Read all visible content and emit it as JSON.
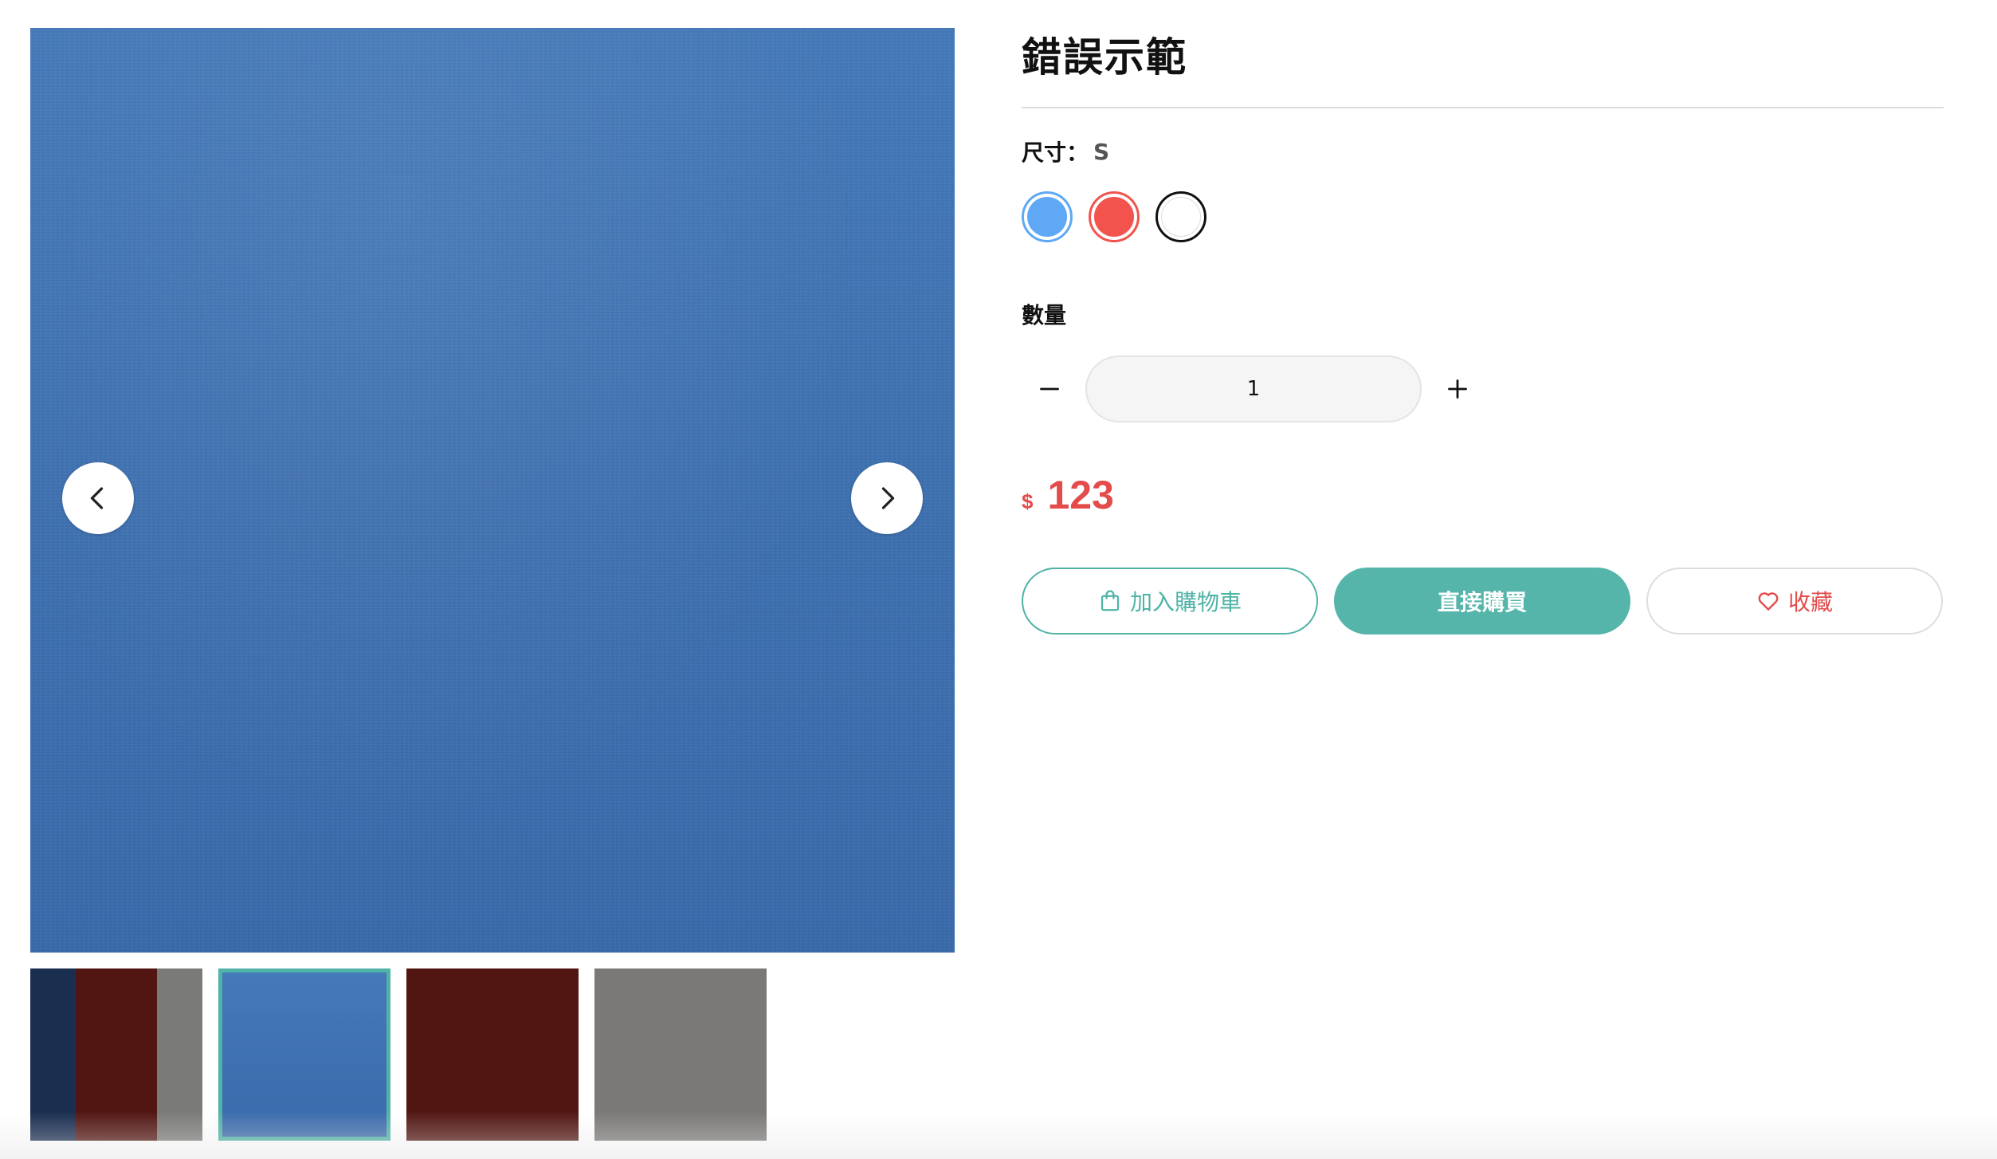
{
  "gallery": {
    "prev_label": "previous image",
    "next_label": "next image",
    "thumbnails": [
      {
        "name": "multi-color"
      },
      {
        "name": "blue",
        "active": true
      },
      {
        "name": "maroon"
      },
      {
        "name": "gray"
      }
    ]
  },
  "product": {
    "title": "錯誤示範",
    "size_label": "尺寸：",
    "size_value": "S",
    "colors": [
      "#5ea8f5",
      "#f2534d",
      "#ffffff"
    ],
    "quantity_label": "數量",
    "quantity_value": "1",
    "price_currency": "$",
    "price_amount": "123"
  },
  "actions": {
    "add_to_cart": "加入購物車",
    "buy_now": "直接購買",
    "favorite": "收藏"
  },
  "icons": {
    "prev": "chevron-left-icon",
    "next": "chevron-right-icon",
    "minus": "minus-icon",
    "plus": "plus-icon",
    "cart": "shopping-bag-icon",
    "favorite": "heart-icon"
  },
  "colors": {
    "accent": "#4fb3a6",
    "price": "#e44b4b",
    "image_blue": "#3e70b0"
  }
}
